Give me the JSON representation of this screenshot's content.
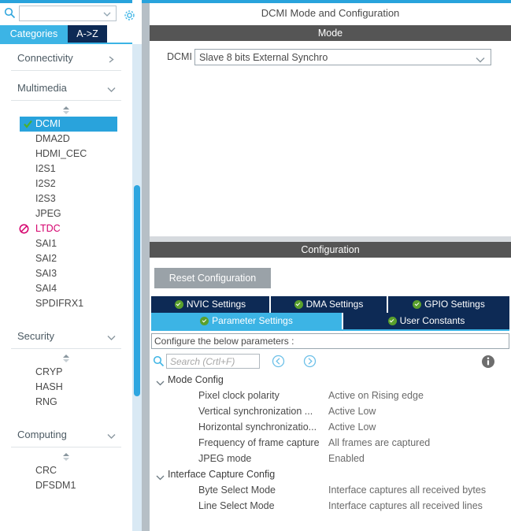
{
  "left_panel": {
    "search": {
      "value": "",
      "icon": "search-icon"
    },
    "settings_icon": "gear-icon",
    "tabs": [
      {
        "label": "Categories",
        "active": true
      },
      {
        "label": "A->Z",
        "active": false
      }
    ],
    "sections": [
      {
        "name": "Connectivity",
        "expanded": false,
        "chevron": "chevron-right-icon",
        "items": []
      },
      {
        "name": "Multimedia",
        "expanded": true,
        "chevron": "chevron-down-icon",
        "items": [
          {
            "label": "DCMI",
            "state": "selected",
            "marker": "check-icon"
          },
          {
            "label": "DMA2D",
            "state": "normal",
            "marker": ""
          },
          {
            "label": "HDMI_CEC",
            "state": "normal",
            "marker": ""
          },
          {
            "label": "I2S1",
            "state": "normal",
            "marker": ""
          },
          {
            "label": "I2S2",
            "state": "normal",
            "marker": ""
          },
          {
            "label": "I2S3",
            "state": "normal",
            "marker": ""
          },
          {
            "label": "JPEG",
            "state": "normal",
            "marker": ""
          },
          {
            "label": "LTDC",
            "state": "warning",
            "marker": "no-entry-icon"
          },
          {
            "label": "SAI1",
            "state": "normal",
            "marker": ""
          },
          {
            "label": "SAI2",
            "state": "normal",
            "marker": ""
          },
          {
            "label": "SAI3",
            "state": "normal",
            "marker": ""
          },
          {
            "label": "SAI4",
            "state": "normal",
            "marker": ""
          },
          {
            "label": "SPDIFRX1",
            "state": "normal",
            "marker": ""
          }
        ]
      },
      {
        "name": "Security",
        "expanded": true,
        "chevron": "chevron-down-icon",
        "items": [
          {
            "label": "CRYP",
            "state": "normal",
            "marker": ""
          },
          {
            "label": "HASH",
            "state": "normal",
            "marker": ""
          },
          {
            "label": "RNG",
            "state": "normal",
            "marker": ""
          }
        ]
      },
      {
        "name": "Computing",
        "expanded": true,
        "chevron": "chevron-down-icon",
        "items": [
          {
            "label": "CRC",
            "state": "normal",
            "marker": ""
          },
          {
            "label": "DFSDM1",
            "state": "normal",
            "marker": ""
          }
        ]
      }
    ]
  },
  "right_panel": {
    "page_title": "DCMI Mode and Configuration",
    "mode": {
      "header": "Mode",
      "field_label": "DCMI",
      "selected_value": "Slave 8 bits External Synchro",
      "dropdown_icon": "chevron-down-icon"
    },
    "configuration": {
      "header": "Configuration",
      "reset_button": "Reset Configuration",
      "tabs_row1": [
        {
          "label": "NVIC Settings",
          "active": false
        },
        {
          "label": "DMA Settings",
          "active": false
        },
        {
          "label": "GPIO Settings",
          "active": false
        }
      ],
      "tabs_row2": [
        {
          "label": "Parameter Settings",
          "active": true
        },
        {
          "label": "User Constants",
          "active": false
        }
      ],
      "instruction": "Configure the below parameters :",
      "search_placeholder": "Search (Crtl+F)",
      "search_value": "",
      "prev_icon": "arrow-left-circle-icon",
      "next_icon": "arrow-right-circle-icon",
      "info_icon": "info-icon",
      "groups": [
        {
          "name": "Mode Config",
          "expanded": true,
          "rows": [
            {
              "name": "Pixel clock polarity",
              "value": "Active on Rising edge"
            },
            {
              "name": "Vertical synchronization ...",
              "value": "Active Low"
            },
            {
              "name": "Horizontal synchronizatio...",
              "value": "Active Low"
            },
            {
              "name": "Frequency of frame capture",
              "value": "All frames are captured"
            },
            {
              "name": "JPEG mode",
              "value": "Enabled"
            }
          ]
        },
        {
          "name": "Interface Capture Config",
          "expanded": true,
          "rows": [
            {
              "name": "Byte Select Mode",
              "value": "Interface captures all received bytes"
            },
            {
              "name": "Line Select Mode",
              "value": "Interface captures all received lines"
            }
          ]
        }
      ]
    }
  },
  "colors": {
    "accent_blue": "#29a3dc",
    "tab_active": "#3cb4e5",
    "tab_inactive": "#0d2a55",
    "header_gray": "#555555",
    "warning_pink": "#d5006d",
    "check_green": "#5aa02c"
  }
}
